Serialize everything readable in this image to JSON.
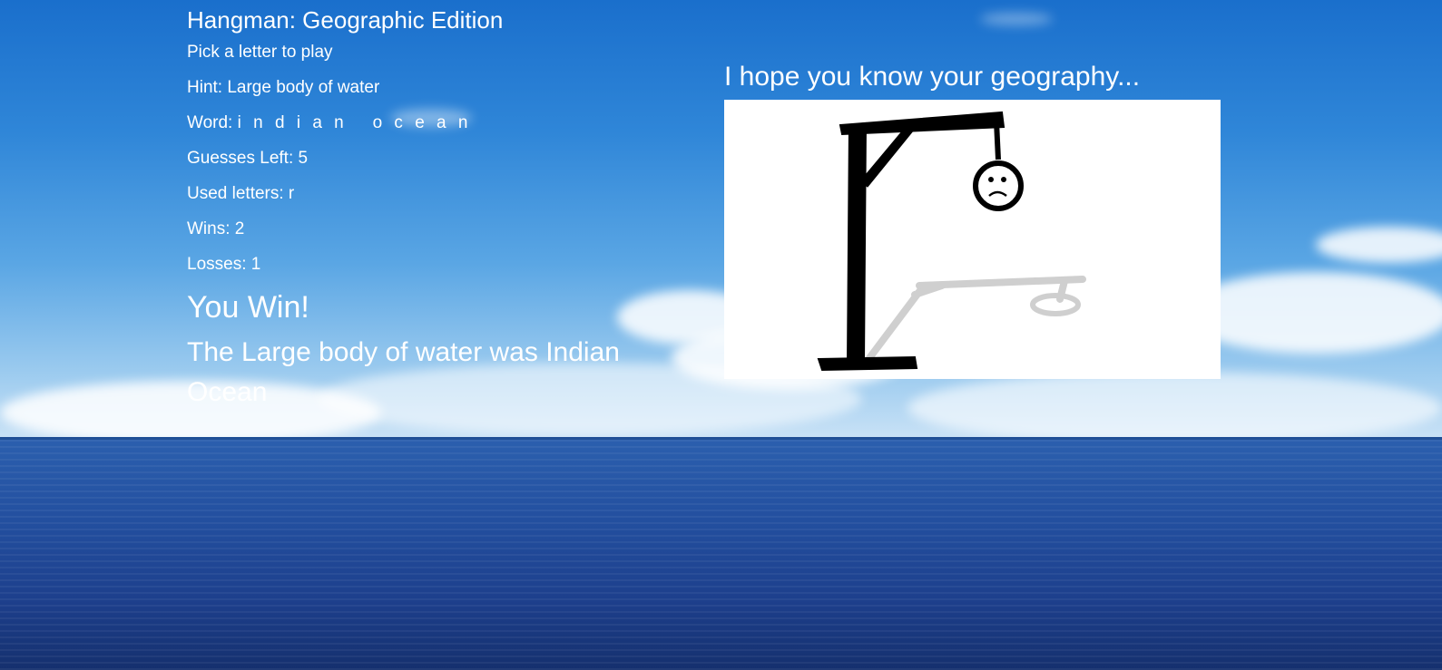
{
  "game": {
    "title": "Hangman: Geographic Edition",
    "instruction": "Pick a letter to play",
    "hint": "Hint: Large body of water",
    "word_label": "Word:",
    "word_value": "i n d i a n   o c e a n",
    "guesses_left": "Guesses Left: 5",
    "used_letters": "Used letters: r",
    "wins": "Wins: 2",
    "losses": "Losses: 1",
    "result_title": "You Win!",
    "result_message": "The Large body of water was Indian Ocean"
  },
  "side": {
    "tagline": "I hope you know your geography..."
  },
  "colors": {
    "text": "#ffffff",
    "sky": "#2f86d8",
    "sea": "#234f9f",
    "panel": "#ffffff"
  }
}
